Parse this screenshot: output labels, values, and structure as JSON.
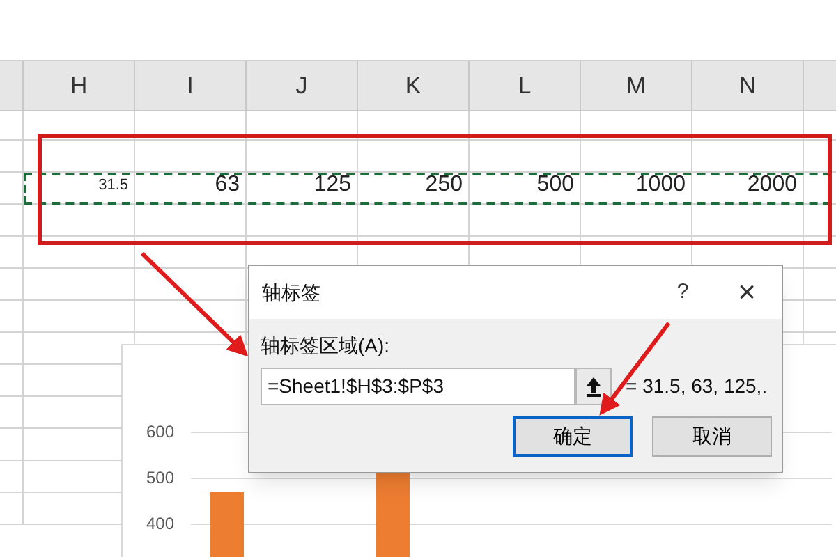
{
  "sheet": {
    "columns": [
      "H",
      "I",
      "J",
      "K",
      "L",
      "M",
      "N"
    ],
    "value_row": [
      "31.5",
      "63",
      "125",
      "250",
      "500",
      "1000",
      "2000"
    ]
  },
  "chart": {
    "y_axis_labels": [
      "600",
      "500",
      "400"
    ]
  },
  "dialog": {
    "title": "轴标签",
    "help": "?",
    "close": "×",
    "field_label": "轴标签区域(A):",
    "field_value": "=Sheet1!$H$3:$P$3",
    "preview": "= 31.5, 63, 125,.",
    "buttons": [
      {
        "label": "确定",
        "selected": true
      },
      {
        "label": "取消",
        "selected": false
      }
    ]
  }
}
